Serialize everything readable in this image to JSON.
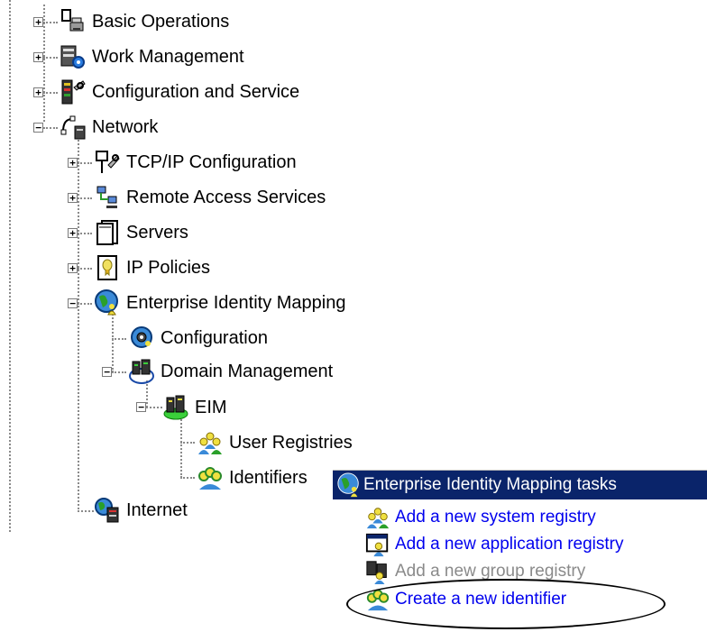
{
  "tree": {
    "items": [
      {
        "label": "Basic Operations",
        "icon": "basic-operations-icon",
        "expander": "+"
      },
      {
        "label": "Work Management",
        "icon": "work-management-icon",
        "expander": "+"
      },
      {
        "label": "Configuration and Service",
        "icon": "configuration-service-icon",
        "expander": "+"
      },
      {
        "label": "Network",
        "icon": "network-icon",
        "expander": "−"
      },
      {
        "label": "TCP/IP Configuration",
        "icon": "tcpip-icon",
        "expander": "+"
      },
      {
        "label": "Remote Access Services",
        "icon": "remote-access-icon",
        "expander": "+"
      },
      {
        "label": "Servers",
        "icon": "servers-icon",
        "expander": "+"
      },
      {
        "label": "IP Policies",
        "icon": "ip-policies-icon",
        "expander": "+"
      },
      {
        "label": "Enterprise Identity Mapping",
        "icon": "eim-globe-icon",
        "expander": "−"
      },
      {
        "label": "Configuration",
        "icon": "eim-configuration-icon"
      },
      {
        "label": "Domain Management",
        "icon": "domain-management-icon",
        "expander": "−"
      },
      {
        "label": "EIM",
        "icon": "eim-domain-icon",
        "expander": "−"
      },
      {
        "label": "User Registries",
        "icon": "user-registries-icon"
      },
      {
        "label": "Identifiers",
        "icon": "identifiers-icon"
      },
      {
        "label": "Internet",
        "icon": "internet-icon"
      }
    ]
  },
  "task_menu": {
    "title": "Enterprise Identity Mapping tasks",
    "items": [
      {
        "label": "Add a new system registry",
        "icon": "system-registry-icon",
        "enabled": true
      },
      {
        "label": "Add a new application registry",
        "icon": "application-registry-icon",
        "enabled": true
      },
      {
        "label": "Add a new group registry",
        "icon": "group-registry-icon",
        "enabled": false
      },
      {
        "label": "Create a new identifier",
        "icon": "identifier-icon",
        "enabled": true,
        "highlighted": true
      }
    ]
  },
  "colors": {
    "selection": "#0a246a",
    "link": "#0000ee",
    "disabled": "#8a8a8a",
    "tree_lines": "#8a8a8a"
  }
}
